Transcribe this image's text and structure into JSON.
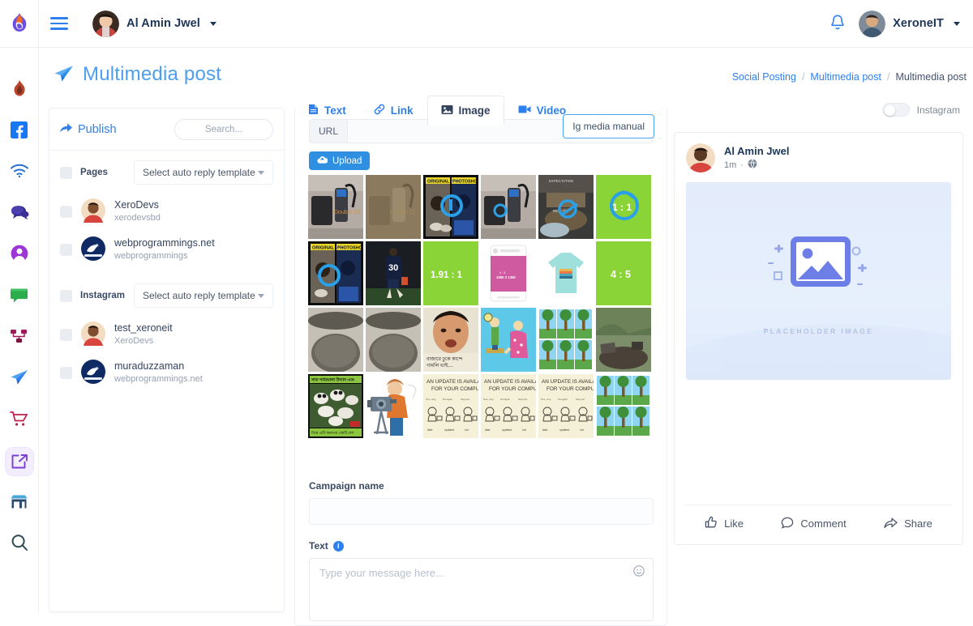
{
  "topbar": {
    "user_name": "Al Amin Jwel",
    "account_name": "XeroneIT",
    "menu_icon": "hamburger-icon",
    "bell_icon": "notification-bell-icon",
    "brand_icon": "app-logo-icon"
  },
  "rail": {
    "items": [
      {
        "name": "fire-icon",
        "label": "Fire",
        "active": false
      },
      {
        "name": "facebook-icon",
        "label": "Facebook",
        "active": false
      },
      {
        "name": "wifi-icon",
        "label": "Wifi",
        "active": false
      },
      {
        "name": "chat-icon",
        "label": "Chat",
        "active": false
      },
      {
        "name": "user-circle-icon",
        "label": "Profile",
        "active": false
      },
      {
        "name": "message-icon",
        "label": "Message",
        "active": false
      },
      {
        "name": "sitemap-icon",
        "label": "Sitemap",
        "active": false
      },
      {
        "name": "paper-plane-icon",
        "label": "Send",
        "active": false
      },
      {
        "name": "cart-icon",
        "label": "Shop",
        "active": false
      },
      {
        "name": "share-square-icon",
        "label": "Social Posting",
        "active": true
      },
      {
        "name": "store-icon",
        "label": "Store",
        "active": false
      },
      {
        "name": "search-icon",
        "label": "Search",
        "active": false
      }
    ]
  },
  "page": {
    "title": "Multimedia post",
    "title_icon": "paper-plane-icon",
    "breadcrumb": {
      "first": "Social Posting",
      "second": "Multimedia post",
      "current": "Multimedia post",
      "separator": "/"
    }
  },
  "publish": {
    "link_label": "Publish",
    "link_icon": "share-icon",
    "search_placeholder": "Search...",
    "pages_label": "Pages",
    "pages_template_value": "Select auto reply template",
    "instagram_label": "Instagram",
    "instagram_template_value": "Select auto reply template",
    "page_accounts": [
      {
        "name": "XeroDevs",
        "handle": "xerodevsbd",
        "avatar": "person-avatar"
      },
      {
        "name": "webprogrammings.net",
        "handle": "webprogrammings",
        "avatar": "dolphin-logo-avatar"
      }
    ],
    "instagram_accounts": [
      {
        "name": "test_xeroneit",
        "handle": "XeroDevs",
        "avatar": "person-avatar"
      },
      {
        "name": "muraduzzaman",
        "handle": "webprogrammings.net",
        "avatar": "dolphin-logo-avatar"
      }
    ]
  },
  "composer": {
    "tabs": [
      {
        "label": "Text",
        "icon": "file-text-icon",
        "active": false
      },
      {
        "label": "Link",
        "icon": "link-icon",
        "active": false
      },
      {
        "label": "Image",
        "icon": "image-icon",
        "active": true
      },
      {
        "label": "Video",
        "icon": "video-icon",
        "active": false
      }
    ],
    "instagram_toggle_label": "Instagram",
    "instagram_toggle_on": false,
    "url_badge": "URL",
    "url_value": "",
    "ig_media_manual_label": "Ig media manual",
    "upload_label": "Upload",
    "upload_icon": "cloud-upload-icon",
    "campaign_label": "Campaign name",
    "campaign_value": "",
    "text_label": "Text",
    "text_info_icon": "info-icon",
    "text_placeholder": "Type your message here...",
    "emoji_icon": "smiley-icon",
    "gallery": [
      {
        "id": "img-1",
        "kind": "photo-phone"
      },
      {
        "id": "img-2",
        "kind": "photo-phone-sepia"
      },
      {
        "id": "img-3",
        "kind": "meme-original-photoshop"
      },
      {
        "id": "img-4",
        "kind": "photo-phone"
      },
      {
        "id": "img-5",
        "kind": "meme-expectation-reality"
      },
      {
        "id": "img-6",
        "kind": "green-ratio-1-1"
      },
      {
        "id": "img-7",
        "kind": "meme-original-photoshop"
      },
      {
        "id": "img-8",
        "kind": "photo-football-30"
      },
      {
        "id": "img-9",
        "kind": "green-ratio-191-1",
        "label": "1.91 : 1"
      },
      {
        "id": "img-10",
        "kind": "pink-card-mockup"
      },
      {
        "id": "img-11",
        "kind": "tshirt-mint"
      },
      {
        "id": "img-12",
        "kind": "green-ratio-4-5",
        "label": "4 : 5"
      },
      {
        "id": "img-13",
        "kind": "photo-texture-gray"
      },
      {
        "id": "img-14",
        "kind": "photo-texture-gray"
      },
      {
        "id": "img-15",
        "kind": "meme-face-bangla"
      },
      {
        "id": "img-16",
        "kind": "cartoon-scale"
      },
      {
        "id": "img-17",
        "kind": "tree-grid-collage"
      },
      {
        "id": "img-18",
        "kind": "photo-outdoor-rock"
      },
      {
        "id": "img-19",
        "kind": "panda-poster"
      },
      {
        "id": "img-20",
        "kind": "cameraman-illustration"
      },
      {
        "id": "img-21",
        "kind": "update-available-sketch"
      },
      {
        "id": "img-22",
        "kind": "update-available-sketch"
      },
      {
        "id": "img-23",
        "kind": "update-available-sketch"
      },
      {
        "id": "img-24",
        "kind": "tree-grid-collage"
      }
    ]
  },
  "preview": {
    "author": "Al Amin Jwel",
    "time": "1m",
    "dot": "·",
    "globe_icon": "globe-icon",
    "placeholder_caption": "PLACEHOLDER IMAGE",
    "actions": [
      {
        "label": "Like",
        "icon": "thumbs-up-icon"
      },
      {
        "label": "Comment",
        "icon": "comment-icon"
      },
      {
        "label": "Share",
        "icon": "share-arrow-icon"
      }
    ]
  },
  "colors": {
    "accent_blue": "#2f80ed",
    "title_blue": "#4c9ff0",
    "upload_blue": "#2f8fe0",
    "green_swatch": "#8bd437",
    "rail_active_bg": "#f3eefe"
  }
}
